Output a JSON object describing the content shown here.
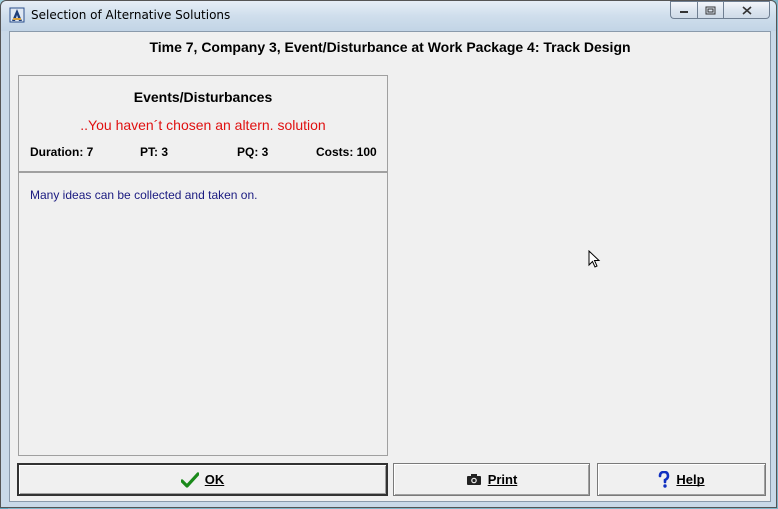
{
  "window": {
    "title": "Selection of Alternative Solutions"
  },
  "heading": "Time 7, Company 3, Event/Disturbance at Work Package 4: Track Design",
  "panel": {
    "title": "Events/Disturbances",
    "status": "..You haven´t chosen an altern. solution",
    "duration": "Duration: 7",
    "pt": "PT: 3",
    "pq": "PQ: 3",
    "costs": "Costs: 100",
    "description": "Many ideas can be collected and taken on."
  },
  "buttons": {
    "ok": "OK",
    "print": "Print",
    "help": "Help"
  },
  "icons": {
    "app": "app-logo-icon",
    "ok": "checkmark-icon",
    "print": "camera-icon",
    "help": "question-mark-icon"
  },
  "colors": {
    "status_red": "#e01010",
    "description_blue": "#1a1a80",
    "checkmark_green": "#1a8a1a",
    "help_blue": "#1030c0"
  }
}
